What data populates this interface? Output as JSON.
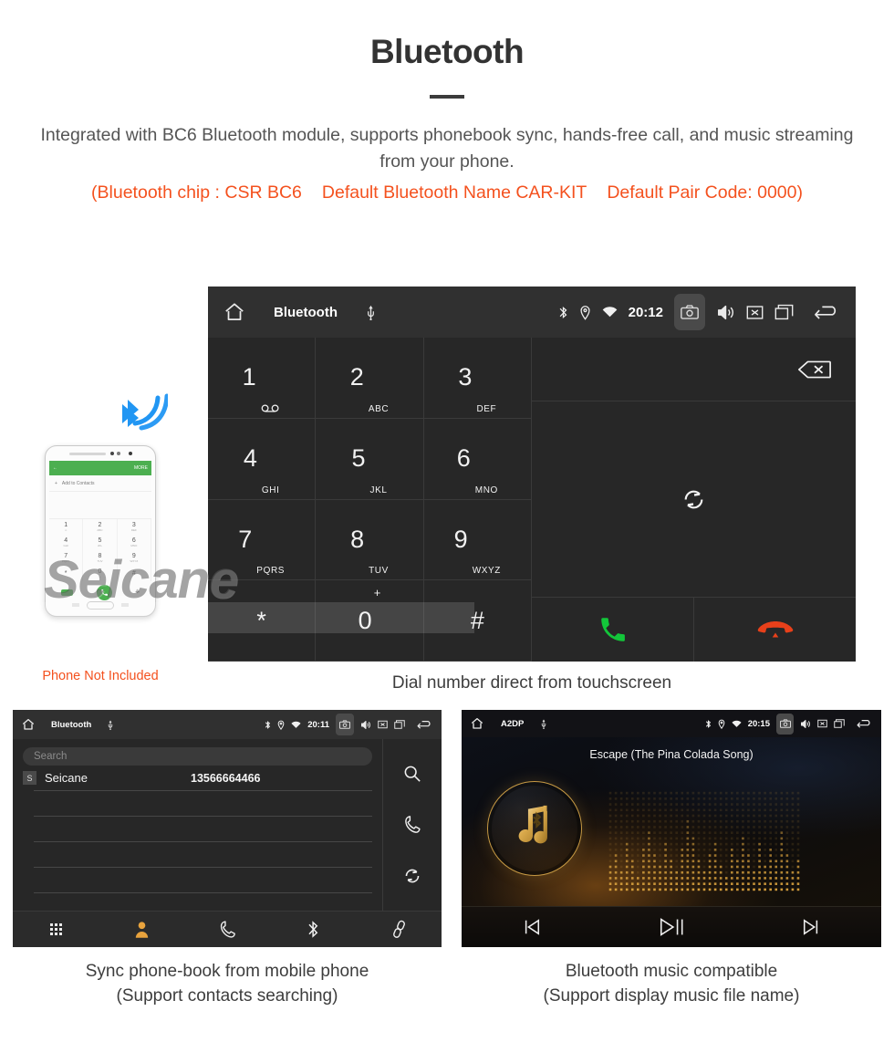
{
  "header": {
    "title": "Bluetooth",
    "intro": "Integrated with BC6 Bluetooth module, supports phonebook sync, hands-free call, and music streaming from your phone.",
    "spec_chip": "(Bluetooth chip : CSR BC6",
    "spec_name": "Default Bluetooth Name CAR-KIT",
    "spec_pair": "Default Pair Code: 0000)",
    "accent_color": "#f4511e",
    "text_color": "#555555"
  },
  "watermark": {
    "text": "Seicane"
  },
  "phone_mock": {
    "caption": "Phone Not Included",
    "app_more_label": "MORE",
    "add_contact_label": "Add to Contacts",
    "keys": [
      {
        "digit": "1",
        "sub": "∞"
      },
      {
        "digit": "2",
        "sub": "ABC"
      },
      {
        "digit": "3",
        "sub": "DEF"
      },
      {
        "digit": "4",
        "sub": "GHI"
      },
      {
        "digit": "5",
        "sub": "JKL"
      },
      {
        "digit": "6",
        "sub": "MNO"
      },
      {
        "digit": "7",
        "sub": "PQRS"
      },
      {
        "digit": "8",
        "sub": "TUV"
      },
      {
        "digit": "9",
        "sub": "WXYZ"
      },
      {
        "digit": "*",
        "sub": ""
      },
      {
        "digit": "0",
        "sub": "+"
      },
      {
        "digit": "#",
        "sub": ""
      }
    ]
  },
  "dialer": {
    "statusbar": {
      "title": "Bluetooth",
      "time": "20:12",
      "icons_left": [
        "home-icon",
        "usb-icon"
      ],
      "icons_status": [
        "bluetooth-icon",
        "location-icon",
        "wifi-icon"
      ],
      "icons_right": [
        "camera-icon",
        "volume-icon",
        "close-box-icon",
        "recents-icon",
        "back-icon"
      ]
    },
    "keys": [
      {
        "digit": "1",
        "sub": "",
        "voicemail": true
      },
      {
        "digit": "2",
        "sub": "ABC"
      },
      {
        "digit": "3",
        "sub": "DEF"
      },
      {
        "digit": "4",
        "sub": "GHI"
      },
      {
        "digit": "5",
        "sub": "JKL"
      },
      {
        "digit": "6",
        "sub": "MNO"
      },
      {
        "digit": "7",
        "sub": "PQRS"
      },
      {
        "digit": "8",
        "sub": "TUV"
      },
      {
        "digit": "9",
        "sub": "WXYZ"
      },
      {
        "digit": "*",
        "sub": ""
      },
      {
        "digit": "0",
        "sup": "+"
      },
      {
        "digit": "#",
        "sub": ""
      }
    ],
    "number_input_value": "",
    "actions": {
      "backspace": "backspace-icon",
      "sync": "sync-icon",
      "call": "call-icon",
      "hangup": "hangup-icon",
      "call_color": "#13c63a",
      "hangup_color": "#e8401a"
    },
    "tabs": [
      {
        "name": "dialpad",
        "active": true
      },
      {
        "name": "contacts",
        "active": false
      },
      {
        "name": "call-log",
        "active": false
      },
      {
        "name": "bluetooth",
        "active": false
      },
      {
        "name": "pair-link",
        "active": false
      }
    ],
    "active_tab_color": "#e8a33d",
    "caption": "Dial number direct from touchscreen"
  },
  "phonebook": {
    "statusbar": {
      "title": "Bluetooth",
      "time": "20:11"
    },
    "search_placeholder": "Search",
    "contacts": [
      {
        "initial": "S",
        "name": "Seicane",
        "number": "13566664466"
      }
    ],
    "empty_rows": 4,
    "side_actions": [
      "search-icon",
      "call-icon",
      "sync-icon"
    ],
    "tabs": [
      {
        "name": "dialpad",
        "active": false
      },
      {
        "name": "contacts",
        "active": true
      },
      {
        "name": "call-log",
        "active": false
      },
      {
        "name": "bluetooth",
        "active": false
      },
      {
        "name": "pair-link",
        "active": false
      }
    ],
    "caption_line1": "Sync phone-book from mobile phone",
    "caption_line2": "(Support contacts searching)"
  },
  "music": {
    "statusbar": {
      "title": "A2DP",
      "time": "20:15"
    },
    "song_title": "Escape (The Pina Colada Song)",
    "album_icon": "music-note-bluetooth-icon",
    "controls": [
      {
        "name": "previous-track",
        "glyph": "prev-icon"
      },
      {
        "name": "play-pause",
        "glyph": "play-pause-icon"
      },
      {
        "name": "next-track",
        "glyph": "next-icon"
      }
    ],
    "visualizer_bars": [
      5,
      7,
      4,
      9,
      6,
      3,
      8,
      11,
      7,
      5,
      9,
      6,
      4,
      8,
      13,
      10,
      6,
      4,
      7,
      9,
      5,
      3,
      8,
      6,
      10,
      7,
      4,
      9,
      5,
      8,
      6,
      11,
      7,
      4,
      6
    ],
    "accent_color": "#d8a13e",
    "caption_line1": "Bluetooth music compatible",
    "caption_line2": "(Support display music file name)"
  }
}
